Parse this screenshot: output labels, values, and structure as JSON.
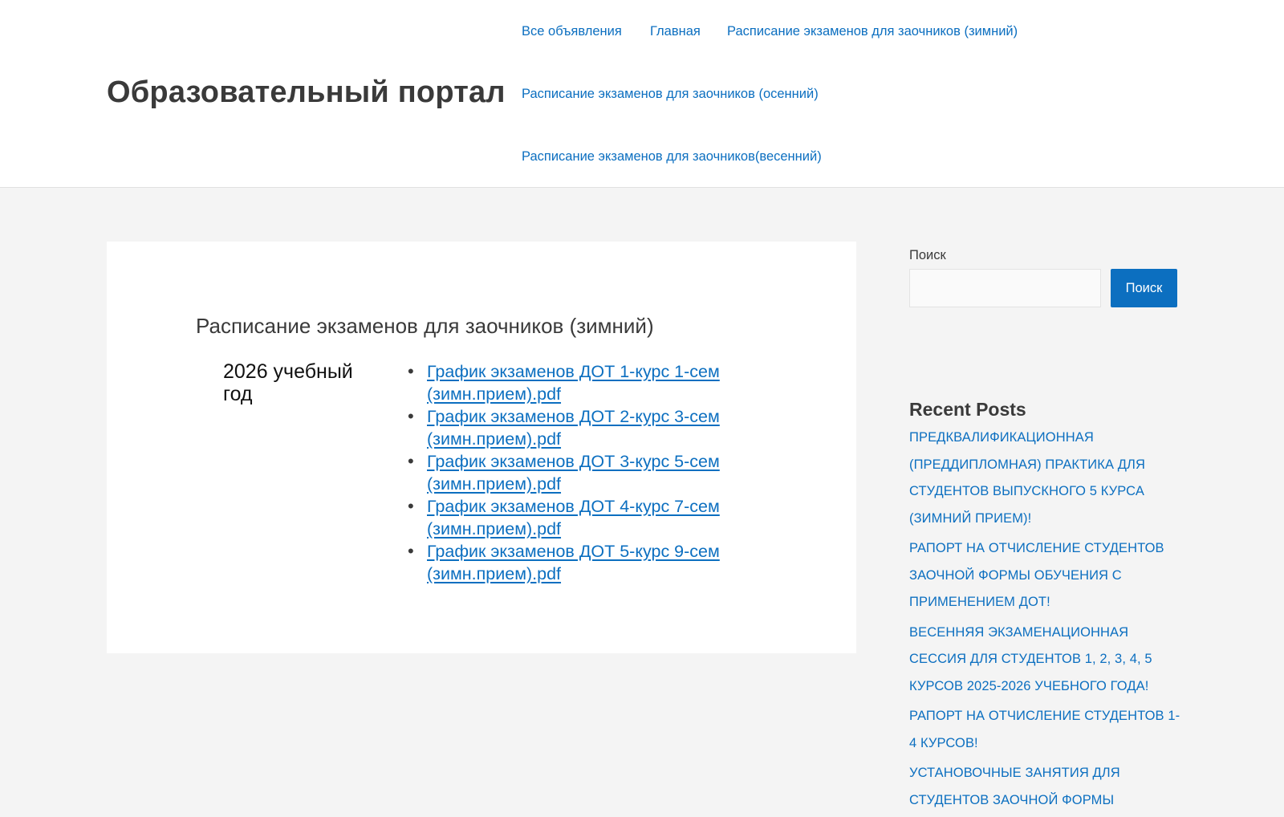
{
  "header": {
    "site_title": "Образовательный портал",
    "nav": [
      "Все объявления",
      "Главная",
      "Расписание экзаменов для заочников (зимний)",
      "Расписание экзаменов для заочников (осенний)",
      "Расписание экзаменов для заочников(весенний)"
    ]
  },
  "main": {
    "title": "Расписание экзаменов для заочников (зимний)",
    "year_label": "2026 учебный год",
    "files": [
      "График экзаменов ДОТ 1-курс 1-сем (зимн.прием).pdf",
      "График экзаменов ДОТ 2-курс 3-сем (зимн.прием).pdf",
      "График экзаменов ДОТ 3-курс 5-сем (зимн.прием).pdf",
      "График экзаменов ДОТ 4-курс 7-сем (зимн.прием).pdf",
      "График экзаменов ДОТ 5-курс 9-сем (зимн.прием).pdf"
    ]
  },
  "sidebar": {
    "search_label": "Поиск",
    "search_value": "",
    "search_button": "Поиск",
    "recent_title": "Recent Posts",
    "recent_posts": [
      "Предквалификационная (преддипломная) практика для студентов выпускного 5 курса (зимний прием)!",
      "Рапорт на отчисление студентов заочной формы обучения с применением ДОТ!",
      "Весенняя экзаменационная сессия для студентов 1, 2, 3, 4, 5 курсов 2025-2026 учебного года!",
      "Рапорт на отчисление студентов 1-4 курсов!",
      "Установочные занятия для студентов заочной формы"
    ]
  },
  "colors": {
    "link": "#0c6fc0",
    "text": "#3a3a3a",
    "background": "#f4f4f4",
    "button": "#0c6fc0"
  }
}
